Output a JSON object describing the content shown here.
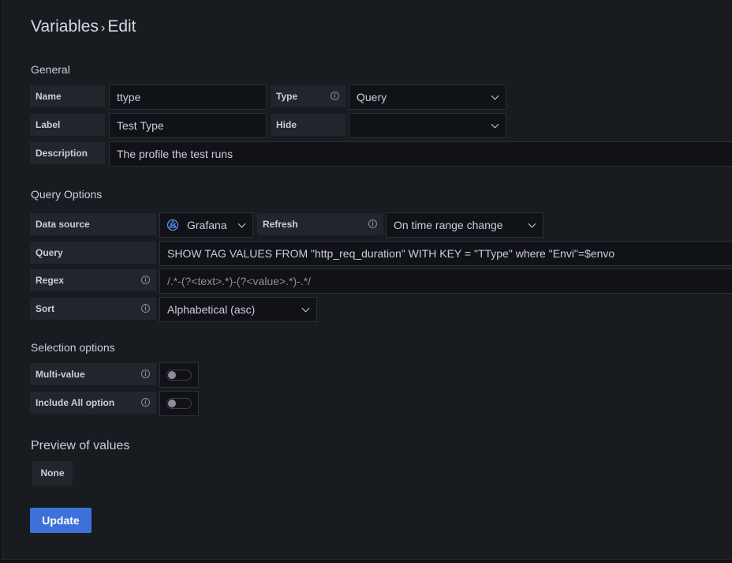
{
  "header": {
    "breadcrumb_parent": "Variables",
    "separator": "›",
    "current": "Edit"
  },
  "general": {
    "section_title": "General",
    "name": {
      "label": "Name",
      "value": "ttype"
    },
    "type": {
      "label": "Type",
      "value": "Query"
    },
    "label_field": {
      "label": "Label",
      "value": "Test Type"
    },
    "hide": {
      "label": "Hide",
      "value": ""
    },
    "description": {
      "label": "Description",
      "value": "The profile the test runs"
    }
  },
  "query_options": {
    "section_title": "Query Options",
    "data_source": {
      "label": "Data source",
      "value": "Grafana",
      "icon": "grafana-icon"
    },
    "refresh": {
      "label": "Refresh",
      "value": "On time range change"
    },
    "query": {
      "label": "Query",
      "value": "SHOW TAG VALUES FROM \"http_req_duration\" WITH KEY = \"TType\" where \"Envi\"=$envo"
    },
    "regex": {
      "label": "Regex",
      "placeholder": "/.*-(?<text>.*)-(?<value>.*)-.*/"
    },
    "sort": {
      "label": "Sort",
      "value": "Alphabetical (asc)"
    }
  },
  "selection_options": {
    "section_title": "Selection options",
    "multi_value": {
      "label": "Multi-value",
      "enabled": false
    },
    "include_all": {
      "label": "Include All option",
      "enabled": false
    }
  },
  "preview": {
    "section_title": "Preview of values",
    "none_label": "None"
  },
  "actions": {
    "update_label": "Update"
  },
  "colors": {
    "background": "#181b1f",
    "primary": "#3d71d9",
    "label_bg": "#22252b",
    "input_bg": "#111217"
  }
}
